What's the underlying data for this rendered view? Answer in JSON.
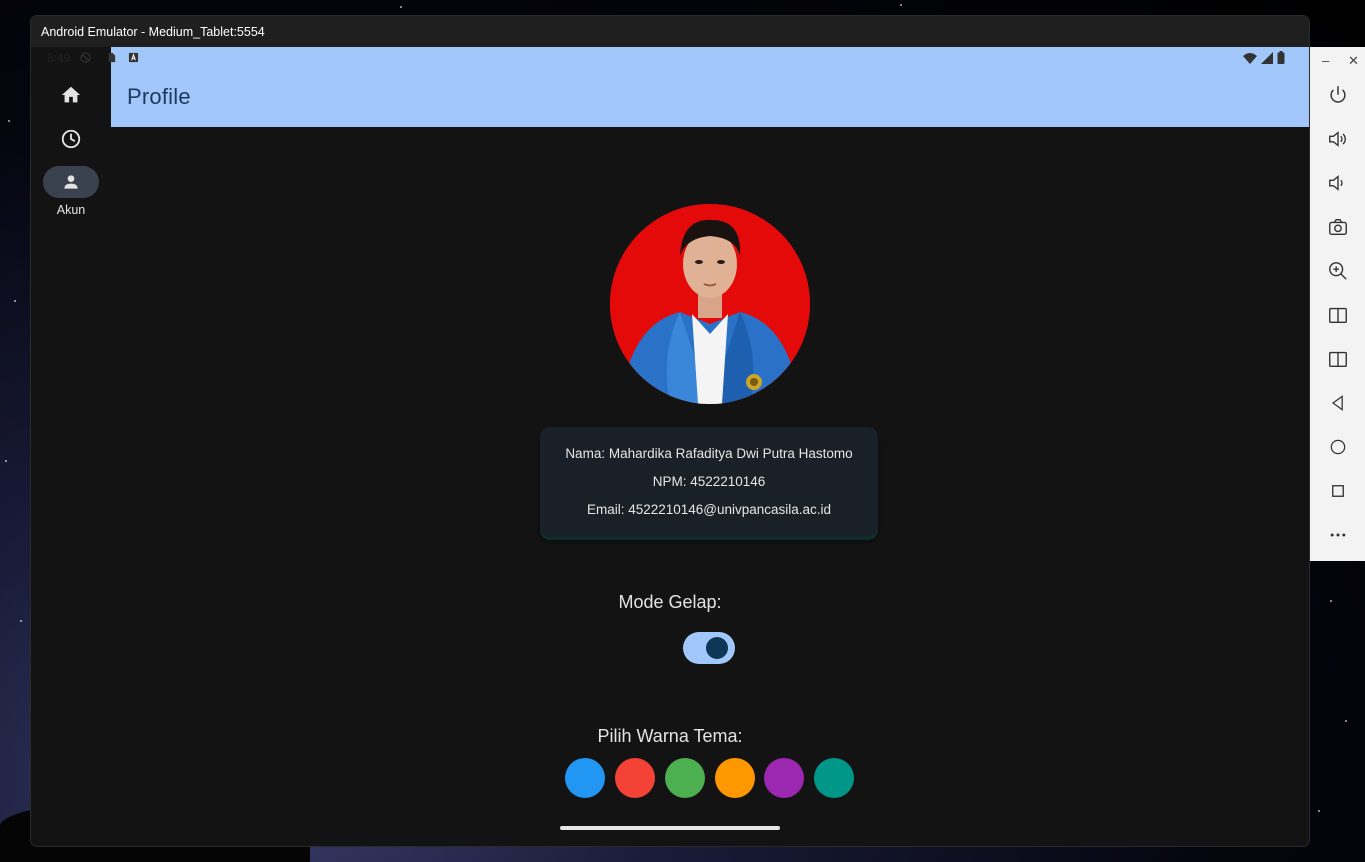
{
  "window": {
    "title": "Android Emulator - Medium_Tablet:5554"
  },
  "status_bar": {
    "time": "5:49"
  },
  "nav_rail": {
    "items": [
      {
        "icon": "home-icon",
        "label": ""
      },
      {
        "icon": "history-icon",
        "label": ""
      },
      {
        "icon": "person-icon",
        "label": "Akun"
      }
    ]
  },
  "app_bar": {
    "title": "Profile"
  },
  "profile": {
    "name_line": "Nama: Mahardika Rafaditya Dwi Putra Hastomo",
    "npm_line": "NPM: 4522210146",
    "email_line": "Email: 4522210146@univpancasila.ac.id"
  },
  "dark_mode": {
    "label": "Mode Gelap:",
    "enabled": true
  },
  "theme": {
    "label": "Pilih Warna Tema:",
    "swatches": [
      "#2196f3",
      "#f44336",
      "#4caf50",
      "#ff9800",
      "#9c27b0",
      "#009688"
    ]
  },
  "colors": {
    "app_bar": "#a2c8fb",
    "background": "#131313",
    "avatar_bg": "#e40a0a"
  },
  "side_toolbar": {
    "icons": [
      "power-icon",
      "volume-up-icon",
      "volume-down-icon",
      "camera-icon",
      "zoom-icon",
      "rotate-left-icon",
      "rotate-right-icon",
      "back-icon",
      "home-circle-icon",
      "overview-icon",
      "more-icon"
    ]
  }
}
